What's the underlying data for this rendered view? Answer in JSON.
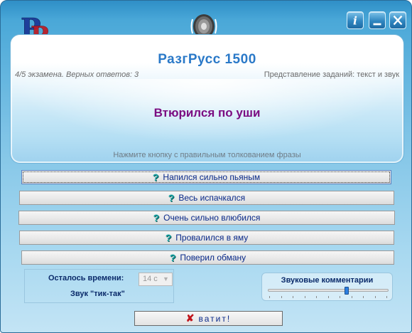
{
  "app": {
    "title": "РазгРусс 1500",
    "exam_status": "4/5 экзамена. Верных ответов: 3",
    "mode_label": "Представление заданий: текст и звук",
    "phrase": "Втюрился по уши",
    "instruction": "Нажмите кнопку с правильным толкованием фразы",
    "logo_letters": "РР"
  },
  "title_buttons": {
    "info": "i",
    "minimize": "_",
    "close": "✕"
  },
  "answers": [
    {
      "label": "Напился сильно пьяным"
    },
    {
      "label": "Весь испачкался"
    },
    {
      "label": "Очень сильно влюбился"
    },
    {
      "label": "Провалился в яму"
    },
    {
      "label": "Поверил обману"
    }
  ],
  "answer_icon": "question-icon",
  "timer": {
    "label": "Осталось времени:",
    "value": "14 с",
    "tick_label": "Звук \"тик-так\""
  },
  "sound": {
    "title": "Звуковые комментарии",
    "level": 0.65
  },
  "enough_button": {
    "label": "ватит!"
  },
  "colors": {
    "title": "#2a79c8",
    "phrase": "#7b0d82",
    "answer_text": "#0a2a8a",
    "question_icon": "#1aa3a3"
  }
}
